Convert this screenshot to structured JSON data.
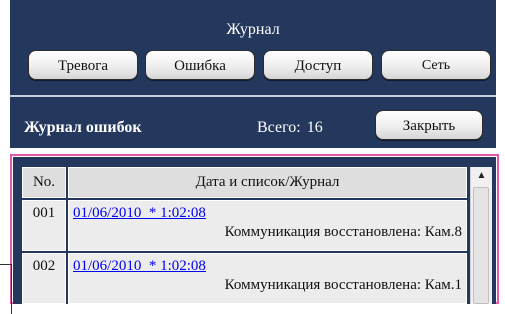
{
  "header": {
    "title": "Журнал",
    "buttons": [
      {
        "label": "Тревога"
      },
      {
        "label": "Ошибка"
      },
      {
        "label": "Доступ"
      },
      {
        "label": "Сеть"
      }
    ]
  },
  "error_log": {
    "title": "Журнал ошибок",
    "total_label": "Всего:",
    "total_value": "16",
    "close_label": "Закрыть"
  },
  "table": {
    "headers": [
      "No.",
      "Дата и список/Журнал"
    ],
    "rows": [
      {
        "no": "001",
        "datetime": "01/06/2010  * 1:02:08",
        "message": "Коммуникация восстановлена: Кам.8"
      },
      {
        "no": "002",
        "datetime": "01/06/2010  * 1:02:08",
        "message": "Коммуникация восстановлена: Кам.1"
      }
    ]
  },
  "icons": {
    "scroll_up": "triangle-up-icon"
  },
  "colors": {
    "panel_bg": "#24385d",
    "highlight_frame": "#e05aa8",
    "link": "#0000ee"
  }
}
